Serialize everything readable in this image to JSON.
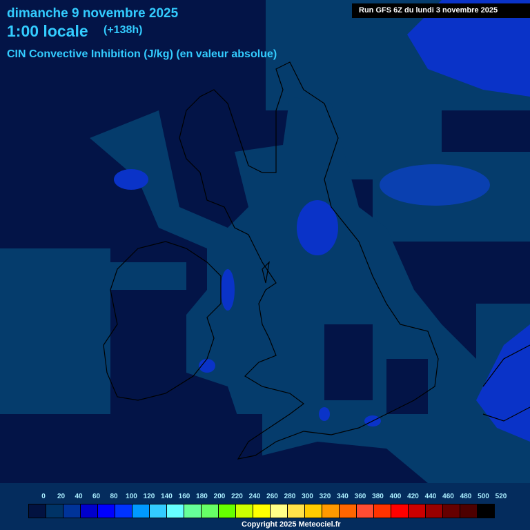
{
  "header": {
    "date": "dimanche 9 novembre 2025",
    "time": "1:00 locale",
    "lead": "(+138h)",
    "parameter": "CIN Convective Inhibition (J/kg) (en valeur absolue)",
    "run": "Run GFS 6Z du lundi 3 novembre 2025"
  },
  "legend": {
    "labels": [
      "0",
      "20",
      "40",
      "60",
      "80",
      "100",
      "120",
      "140",
      "160",
      "180",
      "200",
      "220",
      "240",
      "260",
      "280",
      "300",
      "320",
      "340",
      "360",
      "380",
      "400",
      "420",
      "440",
      "460",
      "480",
      "500",
      "520"
    ],
    "colors": [
      "#021240",
      "#003366",
      "#003399",
      "#0000cc",
      "#0000ff",
      "#0033ff",
      "#0099ff",
      "#33ccff",
      "#66ffff",
      "#66ff99",
      "#66ff66",
      "#66ff00",
      "#ccff00",
      "#ffff00",
      "#ffff88",
      "#ffe24a",
      "#ffcc00",
      "#ff9900",
      "#ff6600",
      "#ff4d33",
      "#ff3300",
      "#ff0000",
      "#cc0000",
      "#990000",
      "#660000",
      "#4d0000",
      "#000000"
    ]
  },
  "colors": {
    "low": "#031447",
    "mid": "#053c6c",
    "high": "#0a33c8",
    "higher": "#0018f0"
  },
  "copyright": "Copyright 2025 Meteociel.fr"
}
